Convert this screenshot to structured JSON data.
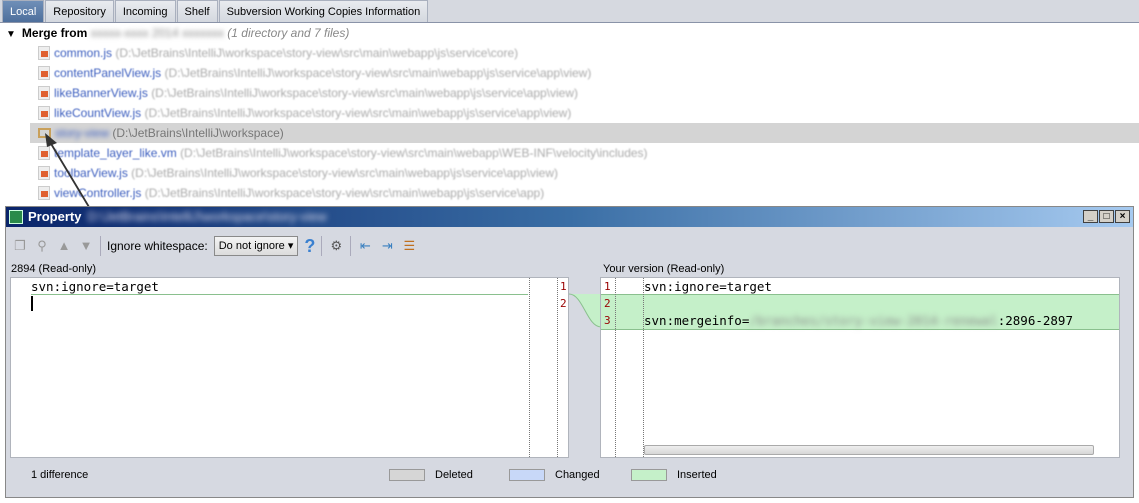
{
  "tabs": [
    {
      "label": "Local",
      "active": true
    },
    {
      "label": "Repository"
    },
    {
      "label": "Incoming"
    },
    {
      "label": "Shelf"
    },
    {
      "label": "Subversion Working Copies Information"
    }
  ],
  "tree": {
    "root_label": "Merge from",
    "root_count": "(1 directory and 7 files)",
    "items": [
      {
        "name": "common.js",
        "path": "(D:\\JetBrains\\IntelliJ\\workspace\\story-view\\src\\main\\webapp\\js\\service\\core)",
        "type": "file"
      },
      {
        "name": "contentPanelView.js",
        "path": "(D:\\JetBrains\\IntelliJ\\workspace\\story-view\\src\\main\\webapp\\js\\service\\app\\view)",
        "type": "file"
      },
      {
        "name": "likeBannerView.js",
        "path": "(D:\\JetBrains\\IntelliJ\\workspace\\story-view\\src\\main\\webapp\\js\\service\\app\\view)",
        "type": "file"
      },
      {
        "name": "likeCountView.js",
        "path": "(D:\\JetBrains\\IntelliJ\\workspace\\story-view\\src\\main\\webapp\\js\\service\\app\\view)",
        "type": "file"
      },
      {
        "name": "story-view",
        "path": "(D:\\JetBrains\\IntelliJ\\workspace)",
        "type": "folder",
        "selected": true
      },
      {
        "name": "template_layer_like.vm",
        "path": "(D:\\JetBrains\\IntelliJ\\workspace\\story-view\\src\\main\\webapp\\WEB-INF\\velocity\\includes)",
        "type": "file"
      },
      {
        "name": "toolbarView.js",
        "path": "(D:\\JetBrains\\IntelliJ\\workspace\\story-view\\src\\main\\webapp\\js\\service\\app\\view)",
        "type": "file"
      },
      {
        "name": "viewController.js",
        "path": "(D:\\JetBrains\\IntelliJ\\workspace\\story-view\\src\\main\\webapp\\js\\service\\app)",
        "type": "file"
      }
    ]
  },
  "dialog": {
    "title": "Property",
    "toolbar": {
      "ignore_label": "Ignore whitespace:",
      "ignore_value": "Do not ignore"
    },
    "left": {
      "header": "2894 (Read-only)",
      "lines": [
        "svn:ignore=target",
        ""
      ],
      "line_numbers": [
        "1",
        "2"
      ]
    },
    "right": {
      "header": "Your version (Read-only)",
      "lines": [
        "svn:ignore=target",
        "",
        "svn:mergeinfo="
      ],
      "line3_suffix": ":2896-2897",
      "line_numbers": [
        "1",
        "2",
        "3"
      ]
    },
    "status": "1 difference",
    "legend": [
      {
        "label": "Deleted",
        "color": "#d6d6d6"
      },
      {
        "label": "Changed",
        "color": "#c8d8f8"
      },
      {
        "label": "Inserted",
        "color": "#c5f0c9"
      }
    ]
  }
}
